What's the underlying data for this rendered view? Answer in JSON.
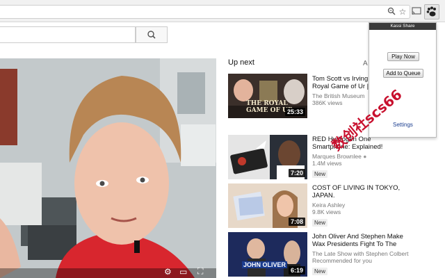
{
  "browser": {
    "zoom_icon": "zoom-icon",
    "bookmark_icon": "star-icon",
    "cast_icon": "cast-icon",
    "extension_icon": "paw-icon"
  },
  "search": {
    "placeholder": "",
    "button_icon": "search-icon"
  },
  "upnext": {
    "heading": "Up next",
    "autoplay_label": "A"
  },
  "videos": [
    {
      "title": "Tom Scott vs Irving Finkel: The Royal Game of Ur | PLAYTHROUGH",
      "title_shown": "Tom Scott vs Irving\nRoyal Game of Ur |",
      "channel": "The British Museum",
      "views": "386K views",
      "badge": "",
      "duration": "25:33",
      "thumb_text": "THE ROYAL\nGAME OF UR"
    },
    {
      "title": "RED Hydrogen One Smartphone: Explained!",
      "title_shown": "RED Hydrogen One\nSmartphone: Explained!",
      "channel": "Marques Brownlee",
      "views": "1.4M views",
      "badge": "New",
      "duration": "7:20",
      "thumb_text": ""
    },
    {
      "title": "COST OF LIVING IN TOKYO, JAPAN.",
      "title_shown": "COST OF LIVING IN TOKYO,\nJAPAN.",
      "channel": "Keira Ashley",
      "views": "9.8K views",
      "badge": "New",
      "duration": "7:08",
      "thumb_text": ""
    },
    {
      "title": "John Oliver And Stephen Make Wax Presidents Fight To The",
      "title_shown": "John Oliver And Stephen Make\nWax Presidents Fight To The",
      "channel": "The Late Show with Stephen Colbert",
      "views": "Recommended for you",
      "badge": "New",
      "duration": "6:19",
      "thumb_text": "JOHN OLIVER"
    }
  ],
  "popup": {
    "header": "Kassi Share",
    "play_now": "Play Now",
    "add_to_queue": "Add to Queue",
    "settings": "Settings"
  },
  "watermark": "数创社scs66",
  "colors": {
    "accent": "#c8102e",
    "link": "#1a3d8f"
  }
}
